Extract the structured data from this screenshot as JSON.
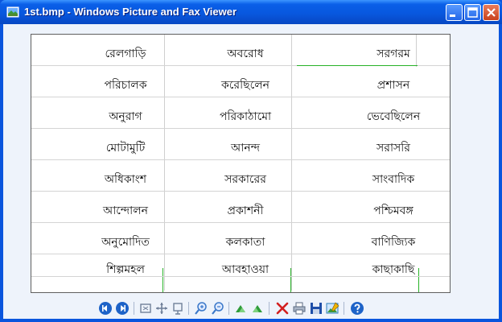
{
  "window": {
    "title": "1st.bmp - Windows Picture and Fax Viewer"
  },
  "image": {
    "words": [
      [
        "রেলগাড়ি",
        "অবরোধ",
        "সরগরম"
      ],
      [
        "পরিচালক",
        "করেছিলেন",
        "প্রশাসন"
      ],
      [
        "অনুরাগ",
        "পরিকাঠামো",
        "ভেবেছিলেন"
      ],
      [
        "মোটামুটি",
        "আনন্দ",
        "সরাসরি"
      ],
      [
        "অধিকাংশ",
        "সরকারের",
        "সাংবাদিক"
      ],
      [
        "আন্দোলন",
        "প্রকাশনী",
        "পশ্চিমবঙ্গ"
      ],
      [
        "অনুমোদিত",
        "কলকাতা",
        "বাণিজ্যিক"
      ],
      [
        "শিল্পমহল",
        "আবহাওয়া",
        "কাছাকাছি"
      ]
    ]
  },
  "toolbar": {
    "buttons": [
      {
        "name": "previous-image-icon",
        "color": "#1e63c8"
      },
      {
        "name": "next-image-icon",
        "color": "#1e63c8"
      },
      {
        "name": "best-fit-icon",
        "color": "#6f7f99"
      },
      {
        "name": "actual-size-icon",
        "color": "#6f7f99"
      },
      {
        "name": "slideshow-icon",
        "color": "#6f7f99"
      },
      {
        "name": "zoom-in-icon",
        "color": "#3b78c9"
      },
      {
        "name": "zoom-out-icon",
        "color": "#3b78c9"
      },
      {
        "name": "rotate-clockwise-icon",
        "color": "#2f9c3a"
      },
      {
        "name": "rotate-counterclockwise-icon",
        "color": "#2f9c3a"
      },
      {
        "name": "delete-icon",
        "color": "#d21f1f"
      },
      {
        "name": "print-icon",
        "color": "#5a6a80"
      },
      {
        "name": "save-icon",
        "color": "#1f4fa8"
      },
      {
        "name": "edit-image-icon",
        "color": "#2f7fb8"
      },
      {
        "name": "help-icon",
        "color": "#1e63c8"
      }
    ]
  }
}
